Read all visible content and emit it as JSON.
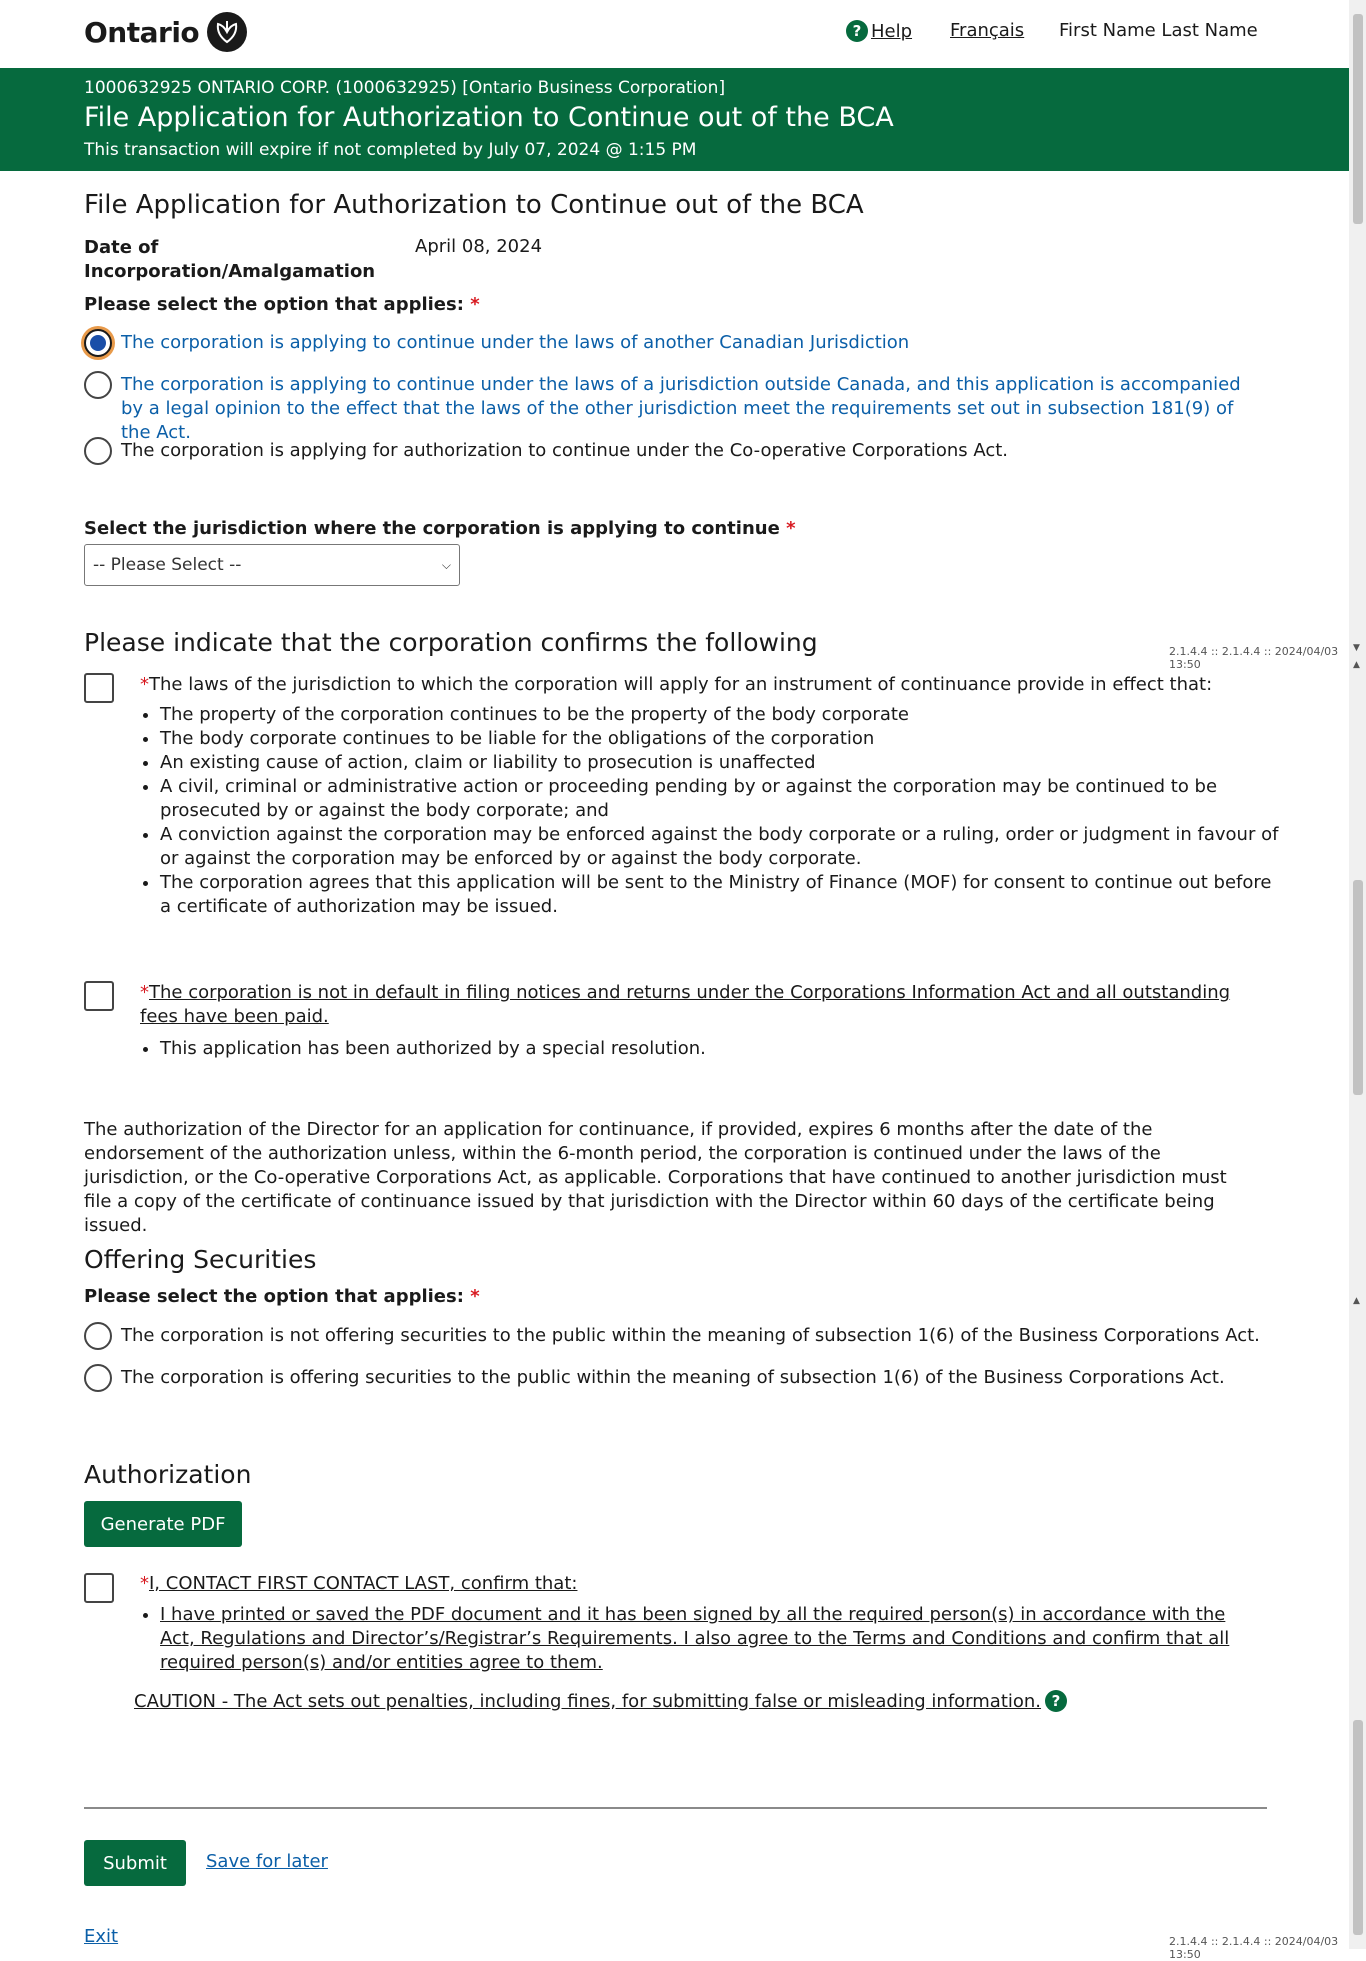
{
  "header": {
    "logo_text": "Ontario",
    "help_label": "Help",
    "language_label": "Français",
    "user_name": "First Name Last Name"
  },
  "banner": {
    "corporation": "1000632925 ONTARIO CORP. (1000632925) [Ontario Business Corporation]",
    "title": "File Application for Authorization to Continue out of the BCA",
    "expiry": "This transaction will expire if not completed by July 07, 2024 @ 1:15 PM"
  },
  "form": {
    "heading": "File Application for Authorization to Continue out of the BCA",
    "date_label_line1": "Date of",
    "date_label_line2": "Incorporation/Amalgamation",
    "date_value": "April 08, 2024",
    "option_prompt": "Please select the option that applies:",
    "required_mark": "*",
    "options": [
      {
        "label": "The corporation is applying to continue under the laws of another Canadian Jurisdiction",
        "selected": true
      },
      {
        "label": "The corporation is applying to continue under the laws of a jurisdiction outside Canada, and this application is accompanied by a legal opinion to the effect that the laws of the other jurisdiction meet the requirements set out in subsection 181(9) of the Act.",
        "selected": false
      },
      {
        "label": "The corporation is applying for authorization to continue under the Co-operative Corporations Act.",
        "selected": false
      }
    ],
    "jurisdiction_label": "Select the jurisdiction where the corporation is applying to continue",
    "jurisdiction_selected": "-- Please Select --"
  },
  "confirm": {
    "heading": "Please indicate that the corporation confirms the following",
    "item1_text": "The laws of the jurisdiction to which the corporation will apply for an instrument of continuance provide in effect that:",
    "item1_bullets": [
      "The property of the corporation continues to be the property of the body corporate",
      "The body corporate continues to be liable for the obligations of the corporation",
      "An existing cause of action, claim or liability to prosecution is unaffected",
      "A civil, criminal or administrative action or proceeding pending by or against the corporation may be continued to be prosecuted by or against the body corporate; and",
      "A conviction against the corporation may be enforced against the body corporate or a ruling, order or judgment in favour of or against the corporation may be enforced by or against the body corporate.",
      "The corporation agrees that this application will be sent to the Ministry of Finance (MOF) for consent to continue out before a certificate of authorization may be issued."
    ],
    "item2_text": "The corporation is not in default in filing notices and returns under the Corporations Information Act and all outstanding fees have been paid.",
    "item2_bullets": [
      "This application has been authorized by a special resolution."
    ],
    "paragraph": "The authorization of the Director for an application for continuance, if provided, expires 6 months after the date of the endorsement of the authorization unless, within the 6-month period, the corporation is continued under the laws of the jurisdiction, or the Co-operative Corporations Act, as applicable. Corporations that have continued to another jurisdiction must file a copy of the certificate of continuance issued by that jurisdiction with the Director within 60 days of the certificate being issued."
  },
  "securities": {
    "heading": "Offering Securities",
    "prompt": "Please select the option that applies:",
    "options": [
      "The corporation is not offering securities to the public within the meaning of subsection 1(6) of the Business Corporations Act.",
      "The corporation is offering securities to the public within the meaning of subsection 1(6) of the Business Corporations Act."
    ]
  },
  "authorization": {
    "heading": "Authorization",
    "generate_pdf": "Generate PDF",
    "confirm_text": "I, CONTACT FIRST CONTACT LAST, confirm that:",
    "bullets": [
      "I have printed or saved the PDF document and it has been signed by all the required person(s) in accordance with the Act, Regulations and Director’s/Registrar’s Requirements. I also agree to the Terms and Conditions and confirm that all required person(s) and/or entities agree to them."
    ],
    "caution": "CAUTION - The Act sets out penalties, including fines, for submitting false or misleading information."
  },
  "actions": {
    "submit": "Submit",
    "save_later": "Save for later",
    "exit": "Exit"
  },
  "version": "2.1.4.4 :: 2.1.4.4 :: 2024/04/03 13:50",
  "colors": {
    "brand_green": "#066a3e",
    "link_blue": "#0b5fa8",
    "required_red": "#d81a21"
  }
}
